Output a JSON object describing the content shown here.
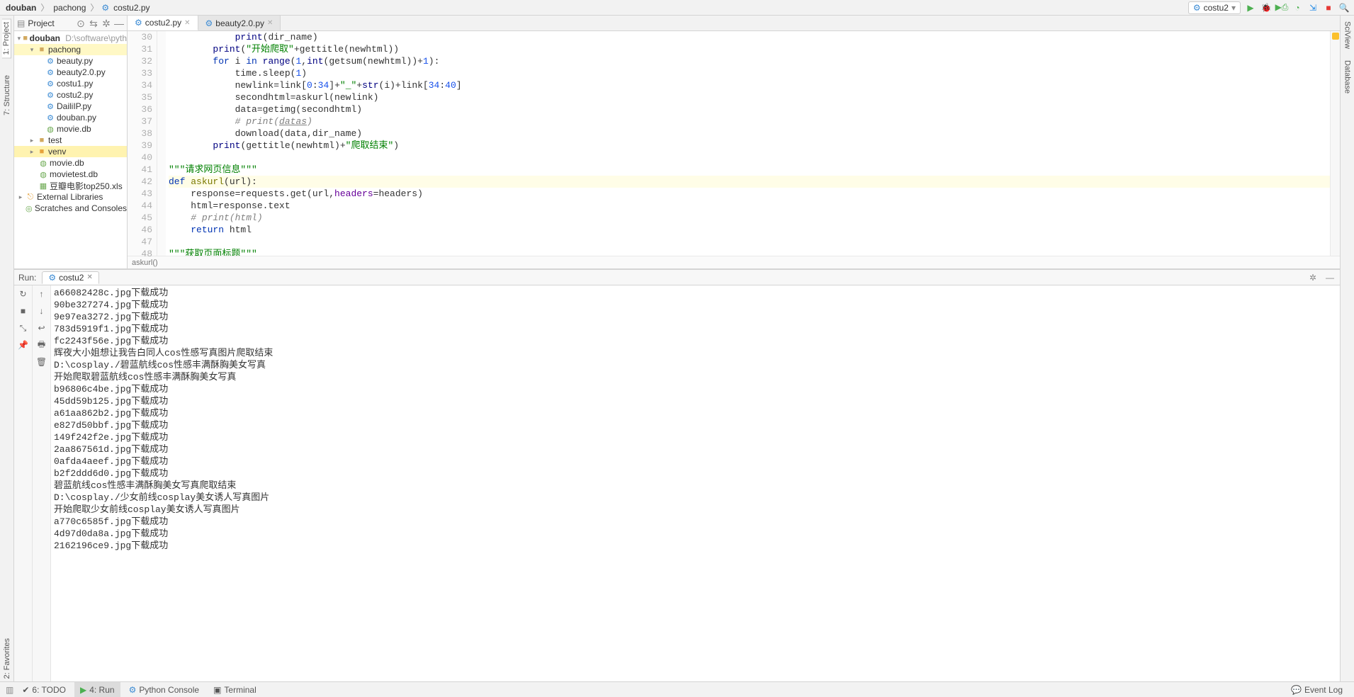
{
  "breadcrumbs": {
    "a": "douban",
    "b": "pachong",
    "c": "costu2.py"
  },
  "run_config_label": "costu2",
  "project": {
    "title": "Project",
    "root": {
      "name": "douban",
      "path": "D:\\software\\pyth"
    },
    "pachong": "pachong",
    "files": {
      "beauty": "beauty.py",
      "beauty2": "beauty2.0.py",
      "costu1": "costu1.py",
      "costu2": "costu2.py",
      "dailiip": "DailiIP.py",
      "douban": "douban.py",
      "moviedb": "movie.db"
    },
    "test": "test",
    "venv": "venv",
    "moviedb2": "movie.db",
    "movietest": "movietest.db",
    "xls": "豆瓣电影top250.xls",
    "ext": "External Libraries",
    "scr": "Scratches and Consoles"
  },
  "tabs": {
    "t1": "costu2.py",
    "t2": "beauty2.0.py"
  },
  "editor": {
    "line_start": 30,
    "lines": [
      {
        "html": "            <span class='bi'>print</span>(dir_name)"
      },
      {
        "html": "        <span class='bi'>print</span>(<span class='str'>\"开始爬取\"</span>+gettitle(newhtml))"
      },
      {
        "html": "        <span class='km'>for</span> i <span class='km'>in</span> <span class='bi'>range</span>(<span class='num'>1</span>,<span class='bi'>int</span>(getsum(newhtml))+<span class='num'>1</span>):"
      },
      {
        "html": "            time.sleep(<span class='num'>1</span>)"
      },
      {
        "html": "            newlink=link[<span class='num'>0</span>:<span class='num'>34</span>]+<span class='str'>\"_\"</span>+<span class='bi'>str</span>(i)+link[<span class='num'>34</span>:<span class='num'>40</span>]"
      },
      {
        "html": "            secondhtml=askurl(newlink)"
      },
      {
        "html": "            data=getimg(secondhtml)"
      },
      {
        "html": "            <span class='cmt'># print(<u>datas</u>)</span>"
      },
      {
        "html": "            download(data,dir_name)"
      },
      {
        "html": "        <span class='bi'>print</span>(gettitle(newhtml)+<span class='str'>\"爬取结束\"</span>)"
      },
      {
        "html": ""
      },
      {
        "html": "<span class='str'>\"\"\"请求网页信息\"\"\"</span>"
      },
      {
        "html": "<span class='km'>def</span> <span class='fn'>askurl</span>(url):",
        "hl": true
      },
      {
        "html": "    response=requests.get(url,<span class='par'>headers</span>=headers)"
      },
      {
        "html": "    html=response.text"
      },
      {
        "html": "    <span class='cmt'># print(html)</span>"
      },
      {
        "html": "    <span class='km'>return</span> html"
      },
      {
        "html": ""
      },
      {
        "html": "<span class='str'>\"\"\"获取页面标题\"\"\"</span>"
      }
    ],
    "breadcrumb_fn": "askurl()"
  },
  "run": {
    "label": "Run:",
    "tab": "costu2",
    "lines": [
      "a66082428c.jpg下载成功",
      "90be327274.jpg下载成功",
      "9e97ea3272.jpg下载成功",
      "783d5919f1.jpg下载成功",
      "fc2243f56e.jpg下载成功",
      "辉夜大小姐想让我告白同人cos性感写真图片爬取结束",
      "D:\\cosplay./碧蓝航线cos性感丰满酥胸美女写真",
      "开始爬取碧蓝航线cos性感丰满酥胸美女写真",
      "b96806c4be.jpg下载成功",
      "45dd59b125.jpg下载成功",
      "a61aa862b2.jpg下载成功",
      "e827d50bbf.jpg下载成功",
      "149f242f2e.jpg下载成功",
      "2aa867561d.jpg下载成功",
      "0afda4aeef.jpg下载成功",
      "b2f2ddd6d0.jpg下载成功",
      "碧蓝航线cos性感丰满酥胸美女写真爬取结束",
      "D:\\cosplay./少女前线cosplay美女诱人写真图片",
      "开始爬取少女前线cosplay美女诱人写真图片",
      "a770c6585f.jpg下载成功",
      "4d97d0da8a.jpg下载成功",
      "2162196ce9.jpg下载成功"
    ]
  },
  "bottom": {
    "todo": "6: TODO",
    "run": "4: Run",
    "pyconsole": "Python Console",
    "terminal": "Terminal",
    "eventlog": "Event Log"
  },
  "side": {
    "project": "1: Project",
    "structure": "7: Structure",
    "favorites": "2: Favorites",
    "sciview": "SciView",
    "database": "Database"
  }
}
